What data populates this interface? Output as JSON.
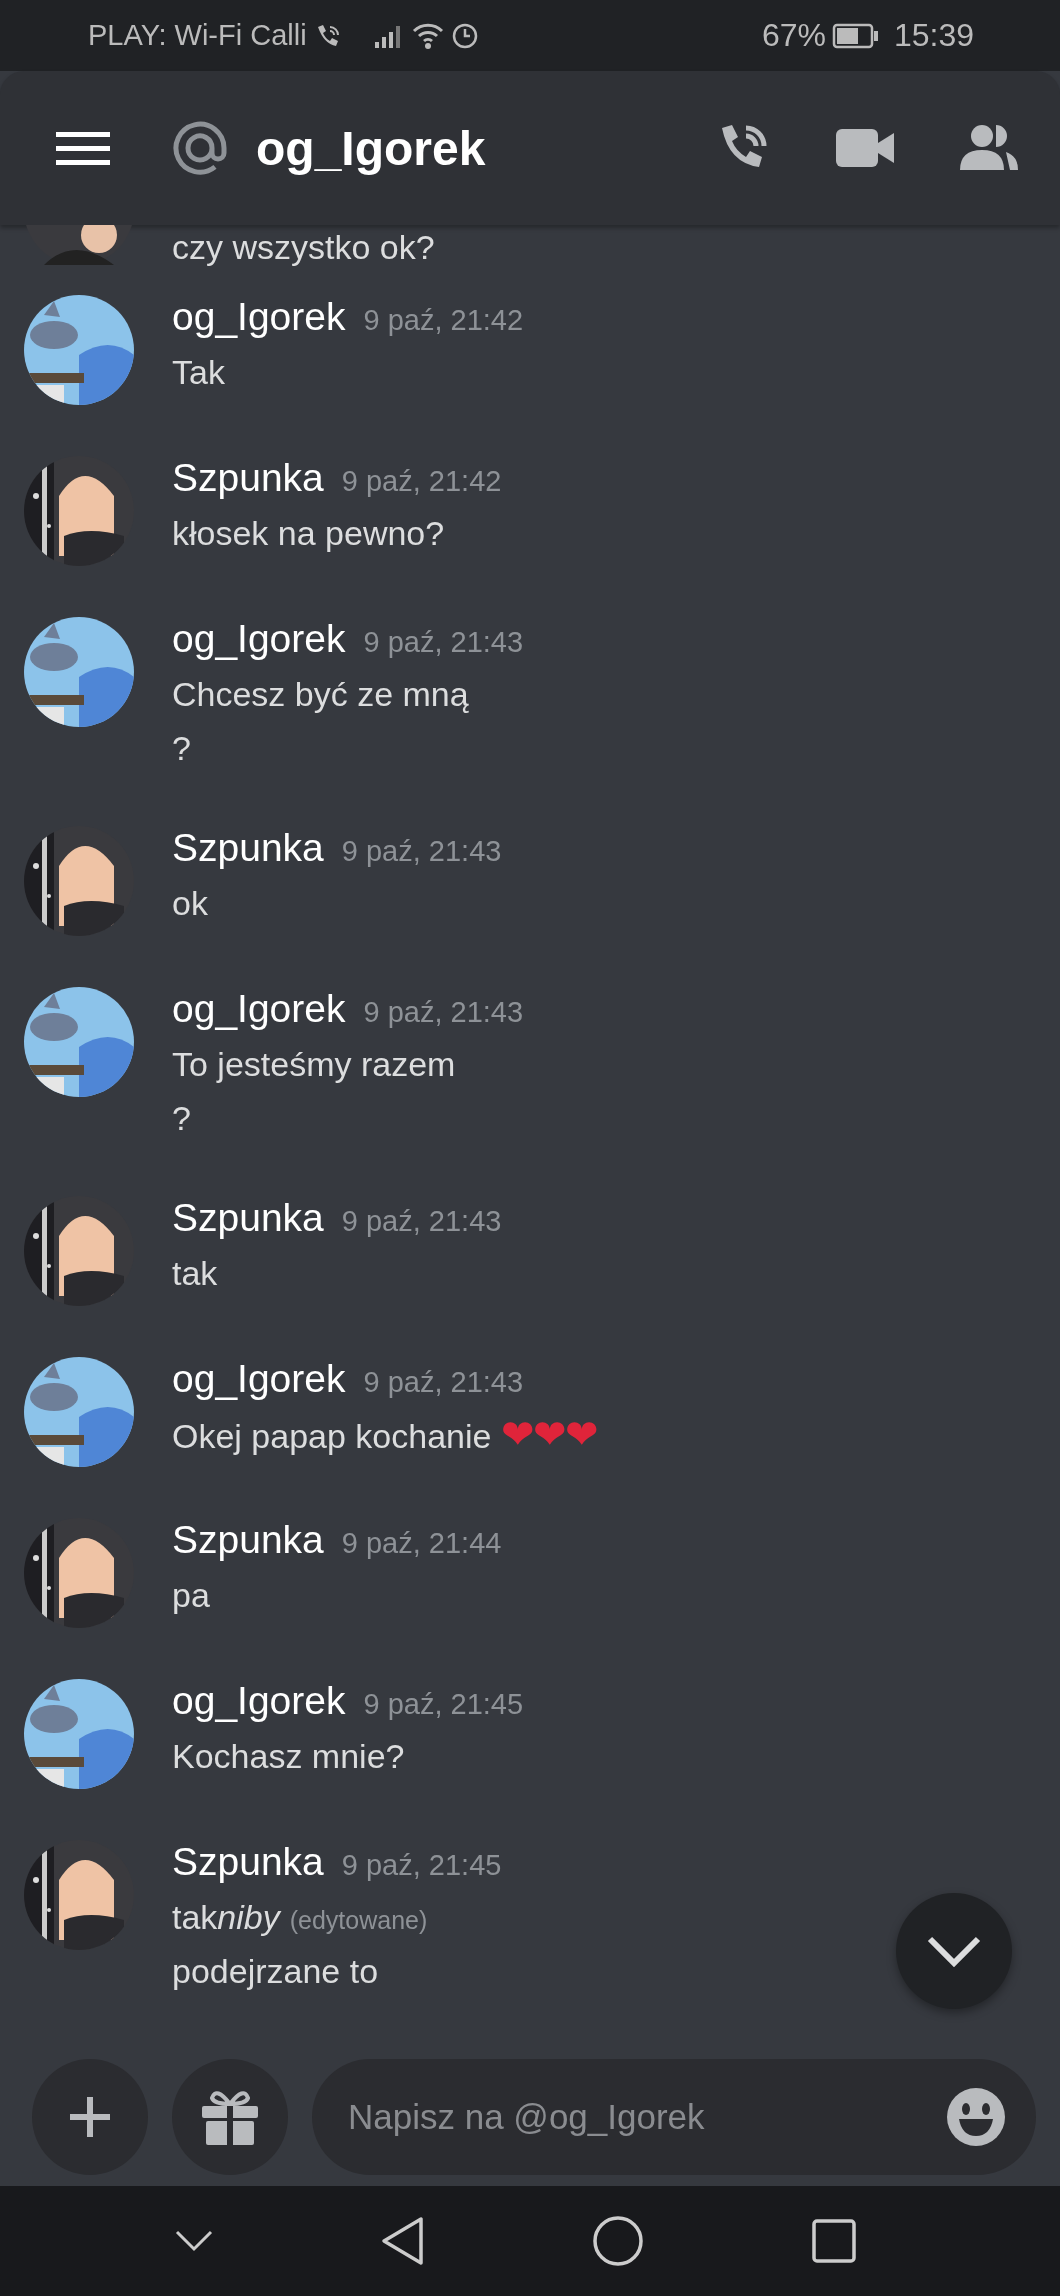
{
  "status_bar": {
    "carrier": "PLAY: Wi-Fi Calli",
    "battery": "67%",
    "time": "15:39"
  },
  "header": {
    "title": "og_Igorek"
  },
  "cut_message": {
    "text": "czy wszystko ok?",
    "avatar": {
      "kind": "dark"
    }
  },
  "messages": [
    {
      "author": "og_Igorek",
      "time": "9 paź, 21:42",
      "avatar": {
        "kind": "sky"
      },
      "lines": [
        {
          "text": "Tak"
        }
      ]
    },
    {
      "author": "Szpunka",
      "time": "9 paź, 21:42",
      "avatar": {
        "kind": "dark"
      },
      "lines": [
        {
          "text": "kłosek na pewno?"
        }
      ]
    },
    {
      "author": "og_Igorek",
      "time": "9 paź, 21:43",
      "avatar": {
        "kind": "sky"
      },
      "lines": [
        {
          "text": "Chcesz być ze mną"
        },
        {
          "text": "?"
        }
      ]
    },
    {
      "author": "Szpunka",
      "time": "9 paź, 21:43",
      "avatar": {
        "kind": "dark"
      },
      "lines": [
        {
          "text": "ok"
        }
      ]
    },
    {
      "author": "og_Igorek",
      "time": "9 paź, 21:43",
      "avatar": {
        "kind": "sky"
      },
      "lines": [
        {
          "text": "To jesteśmy razem"
        },
        {
          "text": "?"
        }
      ]
    },
    {
      "author": "Szpunka",
      "time": "9 paź, 21:43",
      "avatar": {
        "kind": "dark"
      },
      "lines": [
        {
          "text": "tak"
        }
      ]
    },
    {
      "author": "og_Igorek",
      "time": "9 paź, 21:43",
      "avatar": {
        "kind": "sky"
      },
      "lines": [
        {
          "text": "Okej papap kochanie",
          "emoji": "❤❤❤"
        }
      ]
    },
    {
      "author": "Szpunka",
      "time": "9 paź, 21:44",
      "avatar": {
        "kind": "dark"
      },
      "lines": [
        {
          "text": "pa"
        }
      ]
    },
    {
      "author": "og_Igorek",
      "time": "9 paź, 21:45",
      "avatar": {
        "kind": "sky"
      },
      "lines": [
        {
          "text": "Kochasz mnie?"
        }
      ]
    },
    {
      "author": "Szpunka",
      "time": "9 paź, 21:45",
      "avatar": {
        "kind": "dark"
      },
      "lines": [
        {
          "text": "tak",
          "italic": "niby",
          "edited": "(edytowane)"
        },
        {
          "text": "podejrzane to"
        }
      ]
    }
  ],
  "composer": {
    "placeholder": "Napisz na @og_Igorek"
  }
}
